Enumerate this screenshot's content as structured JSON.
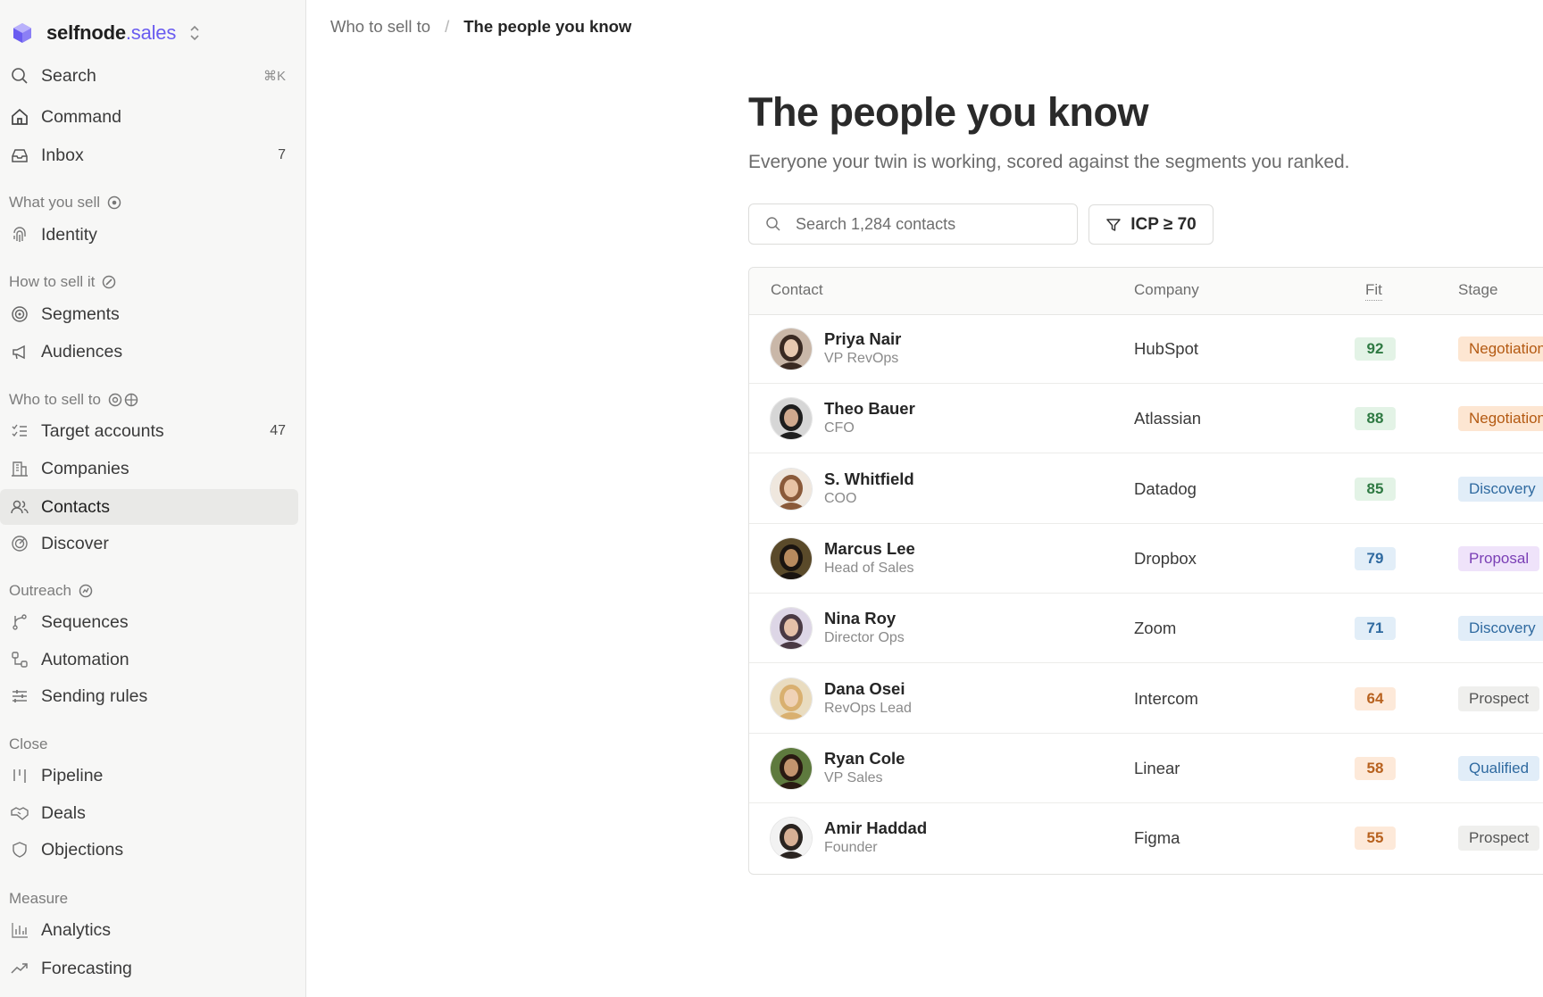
{
  "brand": {
    "name": "selfnode",
    "tld": ".sales"
  },
  "sidebar": {
    "search": {
      "label": "Search",
      "shortcut": "⌘K"
    },
    "top_items": [
      {
        "label": "Command",
        "icon": "home-icon"
      },
      {
        "label": "Inbox",
        "icon": "inbox-icon",
        "count": "7"
      }
    ],
    "sections": [
      {
        "title": "What you sell",
        "items": [
          {
            "label": "Identity",
            "icon": "fingerprint-icon"
          }
        ]
      },
      {
        "title": "How to sell it",
        "items": [
          {
            "label": "Segments",
            "icon": "target-icon"
          },
          {
            "label": "Audiences",
            "icon": "megaphone-icon"
          }
        ]
      },
      {
        "title": "Who to sell to",
        "items": [
          {
            "label": "Target accounts",
            "icon": "list-checks-icon",
            "count": "47"
          },
          {
            "label": "Companies",
            "icon": "building-icon"
          },
          {
            "label": "Contacts",
            "icon": "users-icon",
            "active": true
          },
          {
            "label": "Discover",
            "icon": "radar-icon"
          }
        ]
      },
      {
        "title": "Outreach",
        "items": [
          {
            "label": "Sequences",
            "icon": "git-branch-icon"
          },
          {
            "label": "Automation",
            "icon": "workflow-icon"
          },
          {
            "label": "Sending rules",
            "icon": "sliders-icon"
          }
        ]
      },
      {
        "title": "Close",
        "items": [
          {
            "label": "Pipeline",
            "icon": "kanban-icon"
          },
          {
            "label": "Deals",
            "icon": "handshake-icon"
          },
          {
            "label": "Objections",
            "icon": "shield-icon"
          }
        ]
      },
      {
        "title": "Measure",
        "items": [
          {
            "label": "Analytics",
            "icon": "bar-chart-icon"
          },
          {
            "label": "Forecasting",
            "icon": "trending-up-icon"
          }
        ]
      }
    ]
  },
  "breadcrumb": {
    "parent": "Who to sell to",
    "separator": "/",
    "current": "The people you know"
  },
  "page": {
    "title": "The people you know",
    "subtitle": "Everyone your twin is working, scored against the segments you ranked."
  },
  "search": {
    "placeholder": "Search 1,284 contacts",
    "value": ""
  },
  "filter": {
    "label": "ICP ≥ 70"
  },
  "table": {
    "columns": {
      "contact": "Contact",
      "company": "Company",
      "fit": "Fit",
      "stage": "Stage"
    },
    "rows": [
      {
        "name": "Priya Nair",
        "role": "VP RevOps",
        "company": "HubSpot",
        "fit": "92",
        "stage": "Negotiation"
      },
      {
        "name": "Theo Bauer",
        "role": "CFO",
        "company": "Atlassian",
        "fit": "88",
        "stage": "Negotiation"
      },
      {
        "name": "S. Whitfield",
        "role": "COO",
        "company": "Datadog",
        "fit": "85",
        "stage": "Discovery"
      },
      {
        "name": "Marcus Lee",
        "role": "Head of Sales",
        "company": "Dropbox",
        "fit": "79",
        "stage": "Proposal"
      },
      {
        "name": "Nina Roy",
        "role": "Director Ops",
        "company": "Zoom",
        "fit": "71",
        "stage": "Discovery"
      },
      {
        "name": "Dana Osei",
        "role": "RevOps Lead",
        "company": "Intercom",
        "fit": "64",
        "stage": "Prospect"
      },
      {
        "name": "Ryan Cole",
        "role": "VP Sales",
        "company": "Linear",
        "fit": "58",
        "stage": "Qualified"
      },
      {
        "name": "Amir Haddad",
        "role": "Founder",
        "company": "Figma",
        "fit": "55",
        "stage": "Prospect"
      }
    ]
  },
  "colors": {
    "accent": "#6a5cf0",
    "fit_high_bg": "#e3f3e6",
    "fit_high_fg": "#2f7a43",
    "fit_mid_bg": "#e2eef8",
    "fit_mid_fg": "#2f6aa0",
    "fit_low_bg": "#fde9d9",
    "fit_low_fg": "#b8621f",
    "stage_negotiation_bg": "#fde6d2",
    "stage_negotiation_fg": "#b45a12",
    "stage_discovery_bg": "#e1edf8",
    "stage_discovery_fg": "#2f6aa0",
    "stage_proposal_bg": "#efe3fa",
    "stage_proposal_fg": "#7a3fb5",
    "stage_prospect_bg": "#efefed",
    "stage_prospect_fg": "#555555",
    "stage_qualified_bg": "#e1edf8",
    "stage_qualified_fg": "#2f6aa0"
  }
}
